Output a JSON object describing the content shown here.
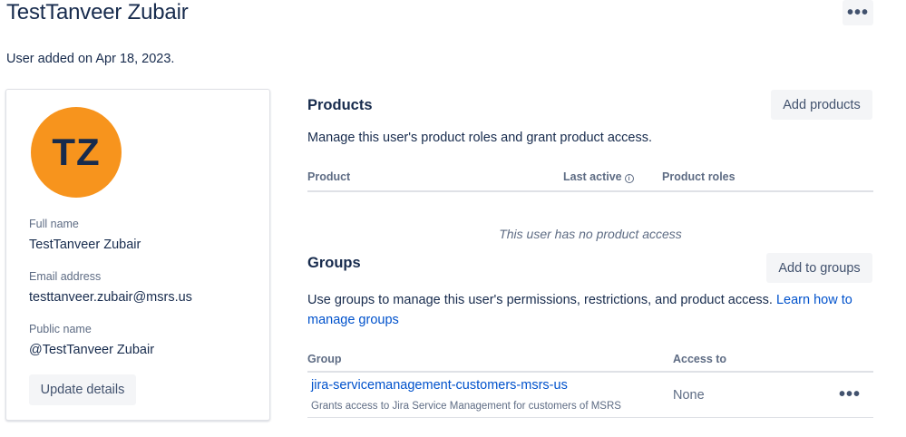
{
  "header": {
    "title": "TestTanveer Zubair",
    "more_icon": "•••",
    "added_on": "User added on Apr 18, 2023."
  },
  "profile": {
    "avatar_initials": "TZ",
    "avatar_color": "#f7941d",
    "full_name_label": "Full name",
    "full_name": "TestTanveer Zubair",
    "email_label": "Email address",
    "email": "testtanveer.zubair@msrs.us",
    "public_name_label": "Public name",
    "public_name": "@TestTanveer Zubair",
    "update_button": "Update details"
  },
  "products": {
    "title": "Products",
    "add_button": "Add products",
    "description": "Manage this user's product roles and grant product access.",
    "columns": [
      "Product",
      "Last active",
      "Product roles"
    ],
    "info_icon": "i",
    "empty_message": "This user has no product access"
  },
  "groups": {
    "title": "Groups",
    "add_button": "Add to groups",
    "description": "Use groups to manage this user's permissions, restrictions, and product access. ",
    "learn_link_line1": "Learn how to",
    "learn_link_line2": "manage groups",
    "columns": [
      "Group",
      "Access to"
    ],
    "rows": [
      {
        "name": "jira-servicemanagement-customers-msrs-us",
        "subtitle": "Grants access to Jira Service Management for customers of MSRS",
        "access": "None",
        "more_icon": "•••"
      }
    ]
  },
  "colors": {
    "link": "#0052cc",
    "text": "#172b4d",
    "subtle": "#5e6c84",
    "button_bg": "#f4f5f7"
  }
}
